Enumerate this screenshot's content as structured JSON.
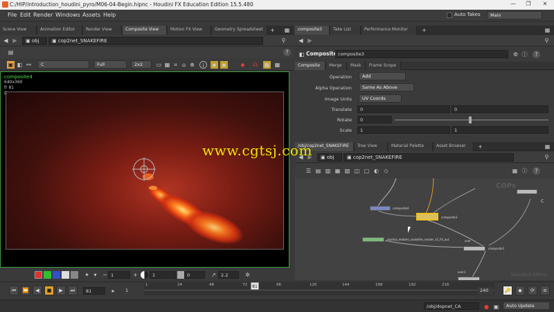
{
  "window": {
    "title": "C:/HIP/introduction_houdini_pyro/M06-04-Begin.hipnc - Houdini FX Education Edition 15.5.480",
    "minimize": "—",
    "maximize": "❐",
    "close": "✕"
  },
  "menu": {
    "items": [
      "File",
      "Edit",
      "Render",
      "Windows",
      "Assets",
      "Help"
    ],
    "auto_takes": "Auto Takes",
    "desktop": "Main"
  },
  "left_tabs": [
    "Scene View",
    "Animation Editor",
    "Render View",
    "Composite View",
    "Motion FX View",
    "Geometry Spreadsheet"
  ],
  "left_path": {
    "root": "obj",
    "network": "cop2net_SNAKEFIRE"
  },
  "viewer_toolbar": {
    "channel": "C",
    "res": "Full",
    "scale": "2x2"
  },
  "viewer": {
    "node_name": "composite4",
    "resolution": "640x360",
    "frame": "fr 81",
    "c_label": "C"
  },
  "viewer_bottom": {
    "value1": "1",
    "value2": "1",
    "value3": "0",
    "value4": "2.2"
  },
  "right_top_tabs": [
    "composite3",
    "Take List",
    "Performance Monitor"
  ],
  "params": {
    "type": "Composite",
    "node_name": "composite3",
    "tabs": [
      "Composite",
      "Merge",
      "Mask",
      "Frame Scope"
    ],
    "operation_label": "Operation",
    "operation_value": "Add",
    "alpha_label": "Alpha Operation",
    "alpha_value": "Same As Above",
    "image_units_label": "Image Units",
    "image_units_value": "UV Coords",
    "translate_label": "Translate",
    "translate_x": "0",
    "translate_y": "0",
    "rotate_label": "Rotate",
    "rotate_value": "0",
    "scale_label": "Scale",
    "scale_x": "1",
    "scale_y": "1"
  },
  "right_bottom_tabs": [
    "/obj/cop2net_SNAKEFIRE",
    "Tree View",
    "Material Palette",
    "Asset Browser"
  ],
  "network_path": {
    "root": "obj",
    "network": "cop2net_SNAKEFIRE"
  },
  "network": {
    "cops_label": "COPs",
    "nodes": {
      "composite4": "composite4",
      "composite3": "composite3",
      "mantra": "mantra_embers_snakefire_render_v2_F4_out",
      "composite1": "composite1",
      "over": "over",
      "over2": "over1",
      "c_label": "C"
    },
    "watermark": "Education Edition"
  },
  "timeline": {
    "start": "1",
    "end": "240",
    "current": "81",
    "frame_field": "81",
    "step_field": "1",
    "ticks": [
      "1",
      "24",
      "48",
      "72",
      "96",
      "120",
      "144",
      "168",
      "192",
      "216"
    ],
    "range_end": "240"
  },
  "statusbar": {
    "path": "/obj/dopnet_CA",
    "update": "Auto Update"
  },
  "watermark_site": "www.cgtsj.com",
  "colors": {
    "accent_orange": "#e8612c",
    "selected_node": "#f0c020",
    "node_green": "#7fb87f",
    "node_blue": "#6a7ab8"
  }
}
